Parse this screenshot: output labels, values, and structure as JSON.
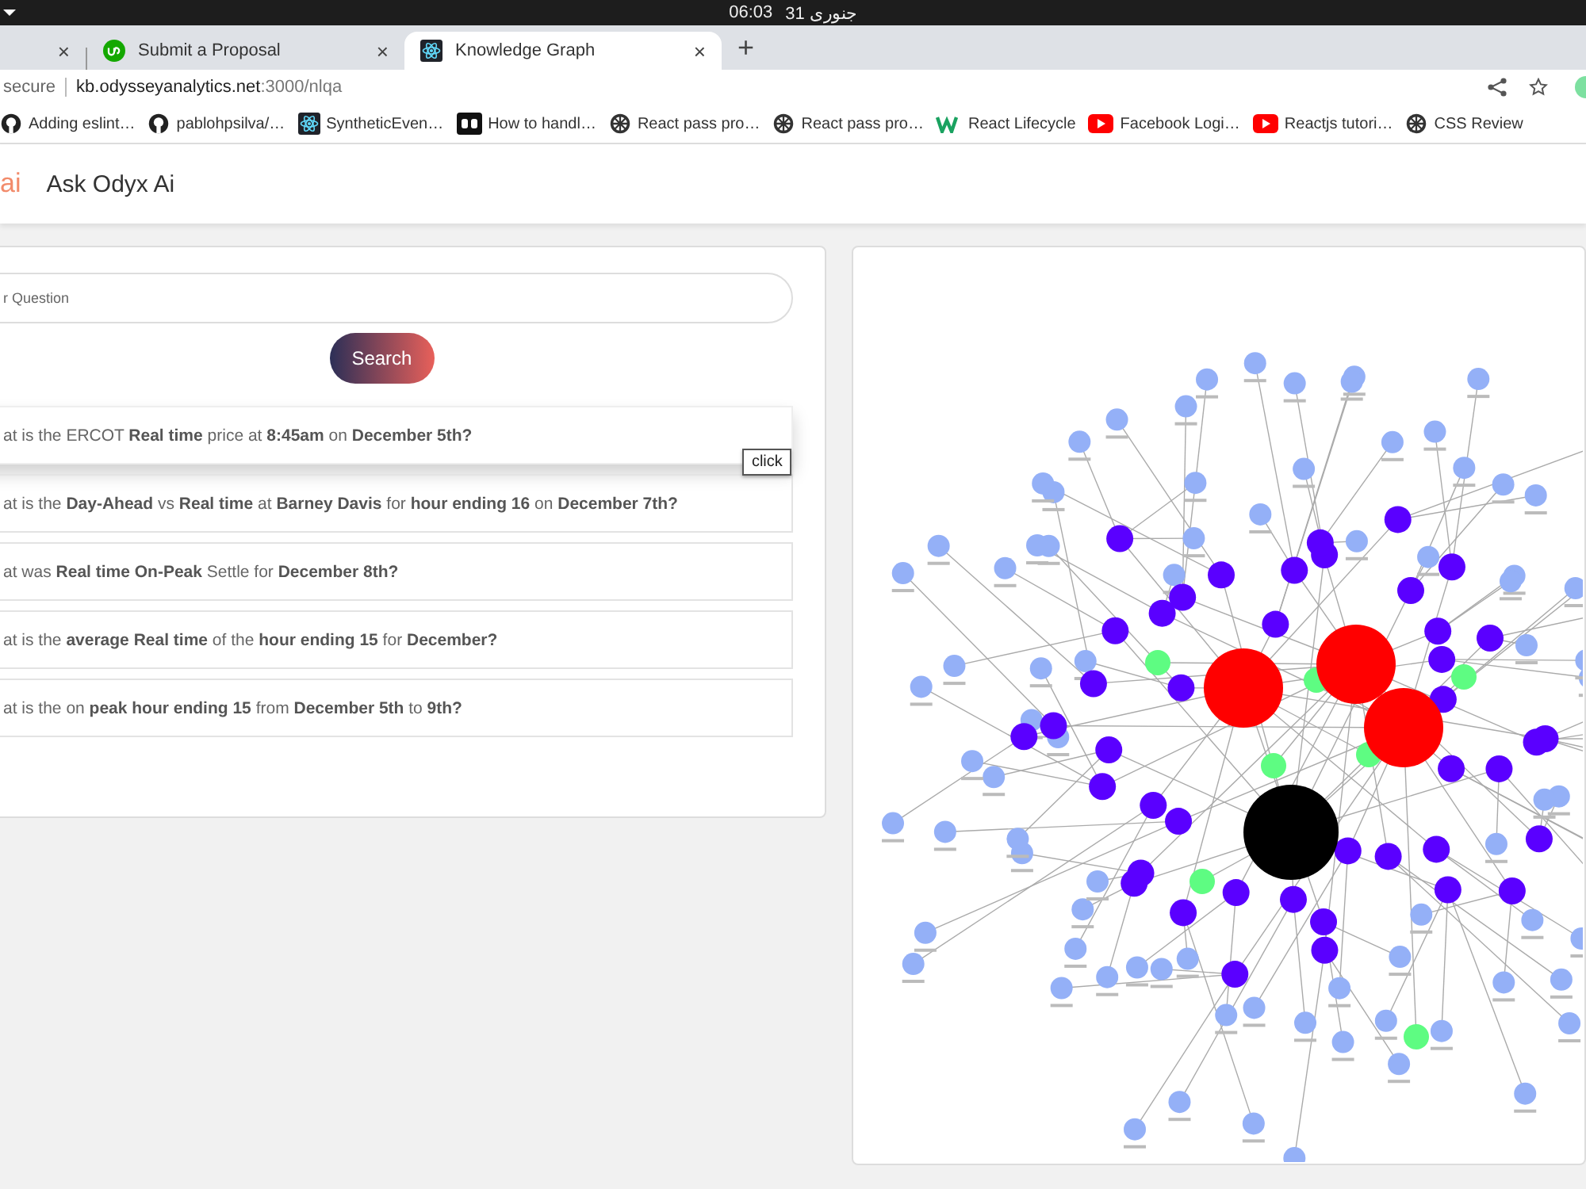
{
  "system_bar": {
    "clock": "06:03",
    "date": "31 جنوری"
  },
  "tabs": [
    {
      "selected": false,
      "kind": "blank",
      "close": "×"
    },
    {
      "title": "Submit a Proposal",
      "selected": false,
      "kind": "upwork",
      "close": "×"
    },
    {
      "title": "Knowledge Graph",
      "selected": true,
      "kind": "react",
      "close": "×"
    }
  ],
  "new_tab": "+",
  "address_bar": {
    "security": "secure",
    "url_host": "kb.odysseyanalytics.net",
    "url_path": ":3000/nlqa"
  },
  "bookmarks": [
    {
      "title": "Adding eslint…",
      "kind": "github"
    },
    {
      "title": "pablohpsilva/…",
      "kind": "github"
    },
    {
      "title": "SyntheticEven…",
      "kind": "react"
    },
    {
      "title": "How to handl…",
      "kind": "dev"
    },
    {
      "title": "React pass pro…",
      "kind": "wheel"
    },
    {
      "title": "React pass pro…",
      "kind": "wheel"
    },
    {
      "title": "React Lifecycle",
      "kind": "w"
    },
    {
      "title": "Facebook Logi…",
      "kind": "youtube"
    },
    {
      "title": "Reactjs tutori…",
      "kind": "youtube"
    },
    {
      "title": "CSS Review",
      "kind": "wheel"
    }
  ],
  "app_header": {
    "logo": "ai",
    "title": "Ask Odyx Ai"
  },
  "search": {
    "placeholder": "r Question",
    "button": "Search"
  },
  "questions": [
    {
      "text": "at is the ERCOT **Real time** price at **8:45am** on **December 5th?**",
      "hovered": true
    },
    {
      "text": "at is the **Day-Ahead** vs **Real time** at **Barney Davis** for **hour ending 16** on **December 7th?**",
      "hovered": false
    },
    {
      "text": "at was **Real time On-Peak** Settle for **December 8th?**",
      "hovered": false
    },
    {
      "text": "at is the **average Real time** of the **hour ending 15** for **December?**",
      "hovered": false
    },
    {
      "text": "at is the on **peak hour ending 15** from **December 5th** to **9th?**",
      "hovered": false
    }
  ],
  "tooltip": "click"
}
